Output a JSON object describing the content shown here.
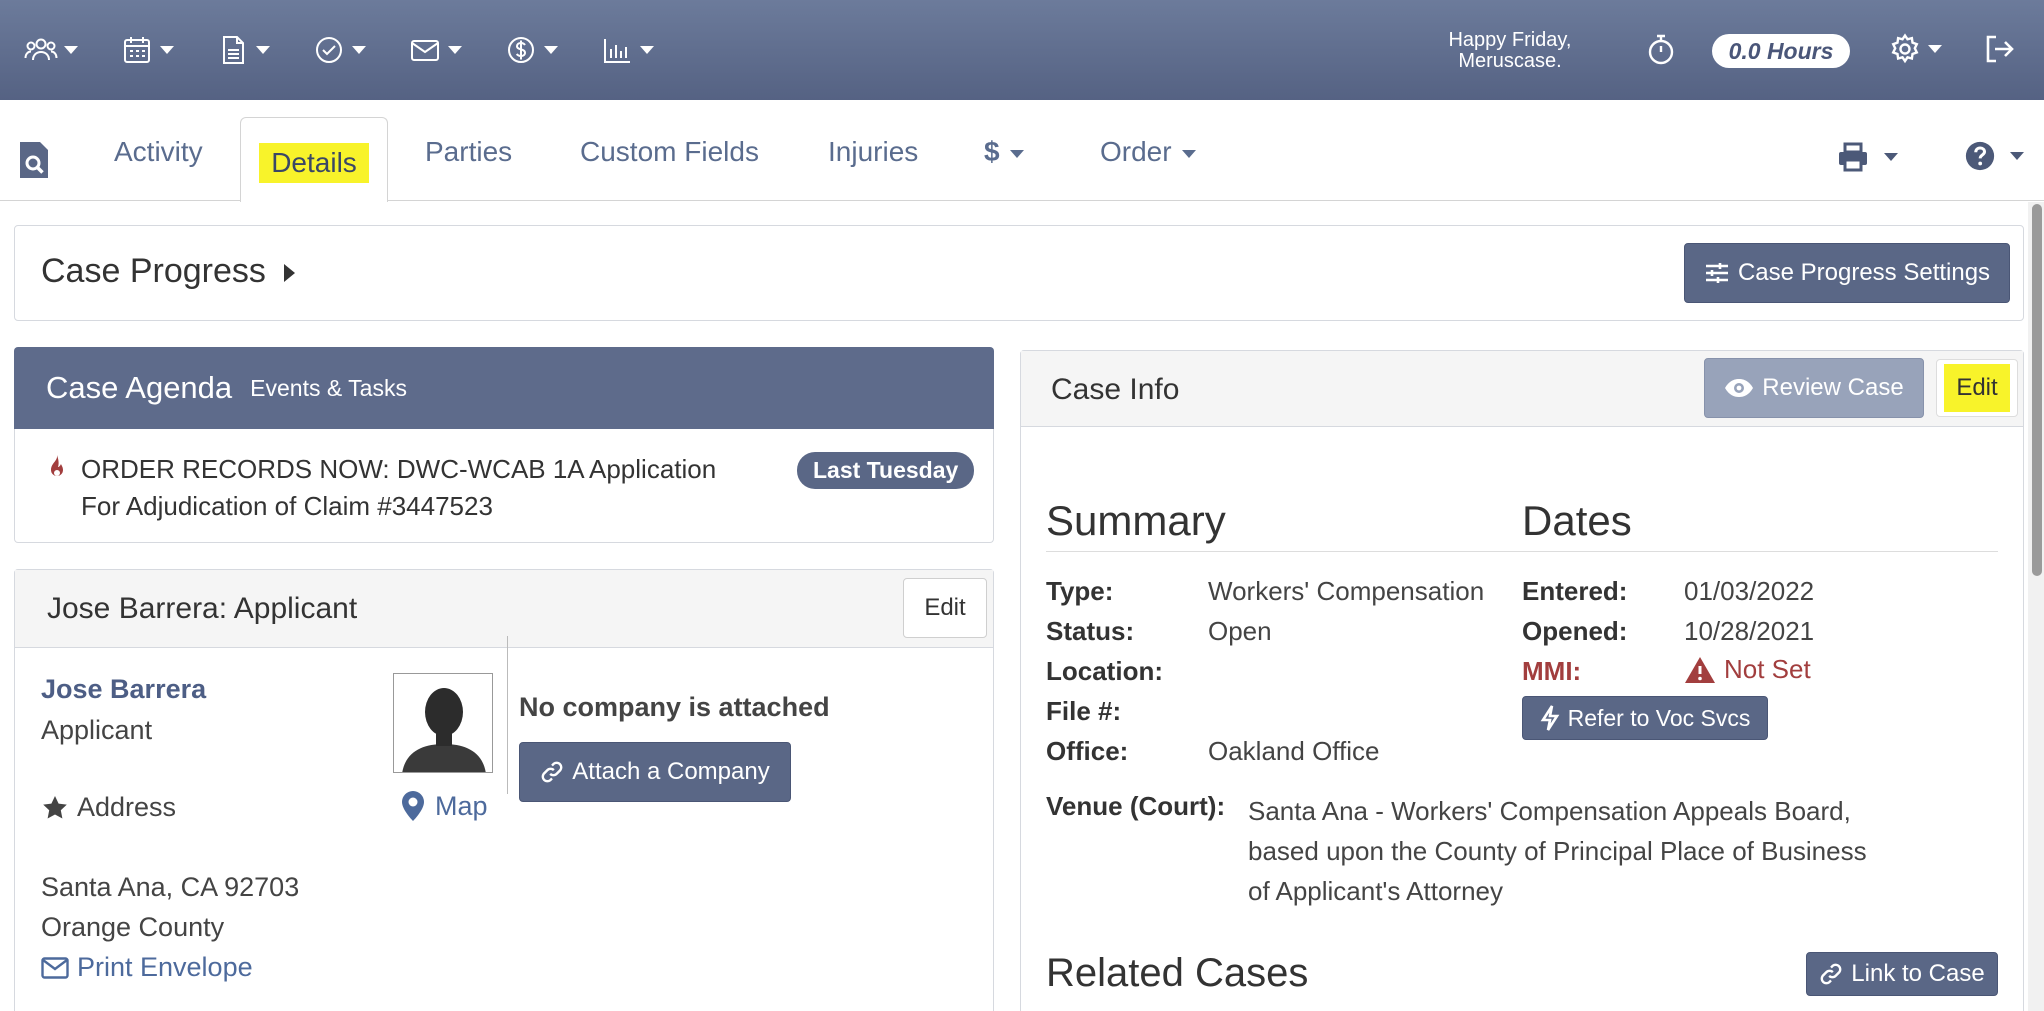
{
  "topbar": {
    "greeting_line1": "Happy Friday,",
    "greeting_line2": "Meruscase.",
    "hours": "0.0 Hours",
    "nav_icons": [
      "people-icon",
      "calendar-icon",
      "document-icon",
      "check-circle-icon",
      "envelope-icon",
      "dollar-circle-icon",
      "bar-chart-icon"
    ],
    "bg_color": "#5f6c8e"
  },
  "tabs": {
    "activity": "Activity",
    "details": "Details",
    "parties": "Parties",
    "custom_fields": "Custom Fields",
    "injuries": "Injuries",
    "dollar": "$",
    "order": "Order"
  },
  "case_progress": {
    "title": "Case Progress",
    "settings_button": "Case Progress Settings"
  },
  "agenda": {
    "title": "Case Agenda",
    "subtitle": "Events & Tasks",
    "item_line1": "ORDER RECORDS NOW: DWC-WCAB 1A Application",
    "item_line2": "For Adjudication of Claim #3447523",
    "badge": "Last Tuesday"
  },
  "applicant": {
    "header": "Jose Barrera: Applicant",
    "edit": "Edit",
    "name": "Jose Barrera",
    "role": "Applicant",
    "address_label": "Address",
    "map": "Map",
    "no_company": "No company is attached",
    "attach_company": "Attach a Company",
    "city": "Santa Ana, CA 92703",
    "county": "Orange County",
    "print_envelope": "Print Envelope"
  },
  "case_info": {
    "title": "Case Info",
    "review_case": "Review Case",
    "edit": "Edit",
    "summary_heading": "Summary",
    "dates_heading": "Dates",
    "type_label": "Type:",
    "type_value": "Workers' Compensation",
    "status_label": "Status:",
    "status_value": "Open",
    "location_label": "Location:",
    "file_label": "File #:",
    "office_label": "Office:",
    "office_value": "Oakland Office",
    "entered_label": "Entered:",
    "entered_value": "01/03/2022",
    "opened_label": "Opened:",
    "opened_value": "10/28/2021",
    "mmi_label": "MMI:",
    "mmi_value": "Not Set",
    "refer_button": "Refer to Voc Svcs",
    "venue_label": "Venue (Court):",
    "venue_value": "Santa Ana - Workers' Compensation Appeals Board, based upon the County of Principal Place of Business of Applicant's Attorney",
    "related_heading": "Related Cases",
    "link_case": "Link to Case"
  },
  "colors": {
    "accent": "#5a6786",
    "highlight": "#f8f32a",
    "warning": "#a23e3e",
    "link": "#4d6a9c"
  }
}
